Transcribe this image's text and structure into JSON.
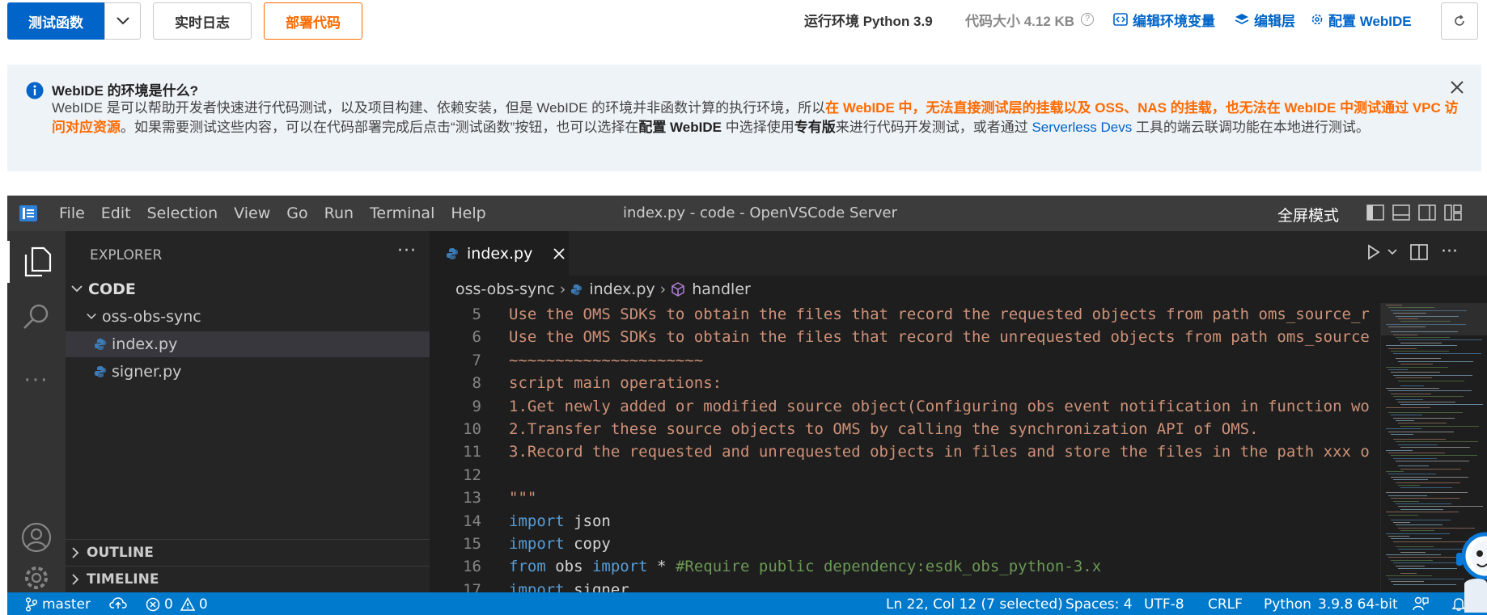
{
  "toolbar": {
    "test_label": "测试函数",
    "log_label": "实时日志",
    "deploy_label": "部署代码",
    "runtime_label": "运行环境 Python 3.9",
    "size_label": "代码大小 4.12 KB",
    "env_label": "编辑环境变量",
    "layer_label": "编辑层",
    "webide_label": "配置 WebIDE"
  },
  "banner": {
    "title": "WebIDE 的环境是什么?",
    "p1": "WebIDE 是可以帮助开发者快速进行代码测试，以及项目构建、依赖安装，但是 WebIDE 的环境并非函数计算的执行环境，所以",
    "p2_orange": "在 WebIDE 中，无法直接测试层的挂载以及 OSS、NAS 的挂载，也无法在 WebIDE 中测试通过 VPC 访问对应资源",
    "p3": "。如果需要测试这些内容，可以在代码部署完成后点击“测试函数”按钮，也可以选择在",
    "p4_bold": "配置 WebIDE",
    "p5": " 中选择使用",
    "p6_bold": "专有版",
    "p7": "来进行代码开发测试，或者通过 ",
    "p8_link": "Serverless Devs",
    "p9": " 工具的端云联调功能在本地进行测试。"
  },
  "vscode": {
    "menu": [
      "File",
      "Edit",
      "Selection",
      "View",
      "Go",
      "Run",
      "Terminal",
      "Help"
    ],
    "window_title": "index.py - code - OpenVSCode Server",
    "fullscreen_label": "全屏模式",
    "explorer_title": "EXPLORER",
    "tree": {
      "root": "CODE",
      "folder": "oss-obs-sync",
      "files": [
        "index.py",
        "signer.py"
      ]
    },
    "sections": [
      "OUTLINE",
      "TIMELINE"
    ],
    "tab_label": "index.py",
    "breadcrumb": [
      "oss-obs-sync",
      "index.py",
      "handler"
    ],
    "code_lines": [
      {
        "n": "5",
        "parts": [
          [
            "str",
            "Use the OMS SDKs to obtain the files that record the requested objects from path oms_source_r"
          ]
        ]
      },
      {
        "n": "6",
        "parts": [
          [
            "str",
            "Use the OMS SDKs to obtain the files that record the unrequested objects from path oms_source"
          ]
        ]
      },
      {
        "n": "7",
        "parts": [
          [
            "str",
            "~~~~~~~~~~~~~~~~~~~~~"
          ]
        ]
      },
      {
        "n": "8",
        "parts": [
          [
            "str",
            "script main operations:"
          ]
        ]
      },
      {
        "n": "9",
        "parts": [
          [
            "str",
            "1.Get newly added or modified source object(Configuring obs event notification in function wo"
          ]
        ]
      },
      {
        "n": "10",
        "parts": [
          [
            "str",
            "2.Transfer these source objects to OMS by calling the synchronization API of OMS."
          ]
        ]
      },
      {
        "n": "11",
        "parts": [
          [
            "str",
            "3.Record the requested and unrequested objects in files and store the files in the path xxx o"
          ]
        ]
      },
      {
        "n": "12",
        "parts": []
      },
      {
        "n": "13",
        "parts": [
          [
            "str",
            "\"\"\""
          ]
        ]
      },
      {
        "n": "14",
        "parts": [
          [
            "kw2",
            "import"
          ],
          [
            "id",
            " json"
          ]
        ]
      },
      {
        "n": "15",
        "parts": [
          [
            "kw2",
            "import"
          ],
          [
            "id",
            " copy"
          ]
        ]
      },
      {
        "n": "16",
        "parts": [
          [
            "kw2",
            "from"
          ],
          [
            "id",
            " obs "
          ],
          [
            "kw2",
            "import"
          ],
          [
            "id",
            " * "
          ],
          [
            "cm",
            "#Require public dependency:esdk_obs_python-3.x"
          ]
        ]
      },
      {
        "n": "17",
        "parts": [
          [
            "kw2",
            "import"
          ],
          [
            "id",
            " signer"
          ]
        ]
      }
    ],
    "status": {
      "branch": "master",
      "errors": "0",
      "warnings": "0",
      "position": "Ln 22, Col 12 (7 selected)",
      "spaces": "Spaces: 4",
      "encoding": "UTF-8",
      "eol": "CRLF",
      "language": "Python",
      "interpreter": "3.9.8 64-bit"
    }
  },
  "colors": {
    "primary": "#0064c8",
    "deploy_orange": "#ff6a00",
    "vscode_status": "#007acc",
    "editor_bg": "#1e1e1e"
  }
}
